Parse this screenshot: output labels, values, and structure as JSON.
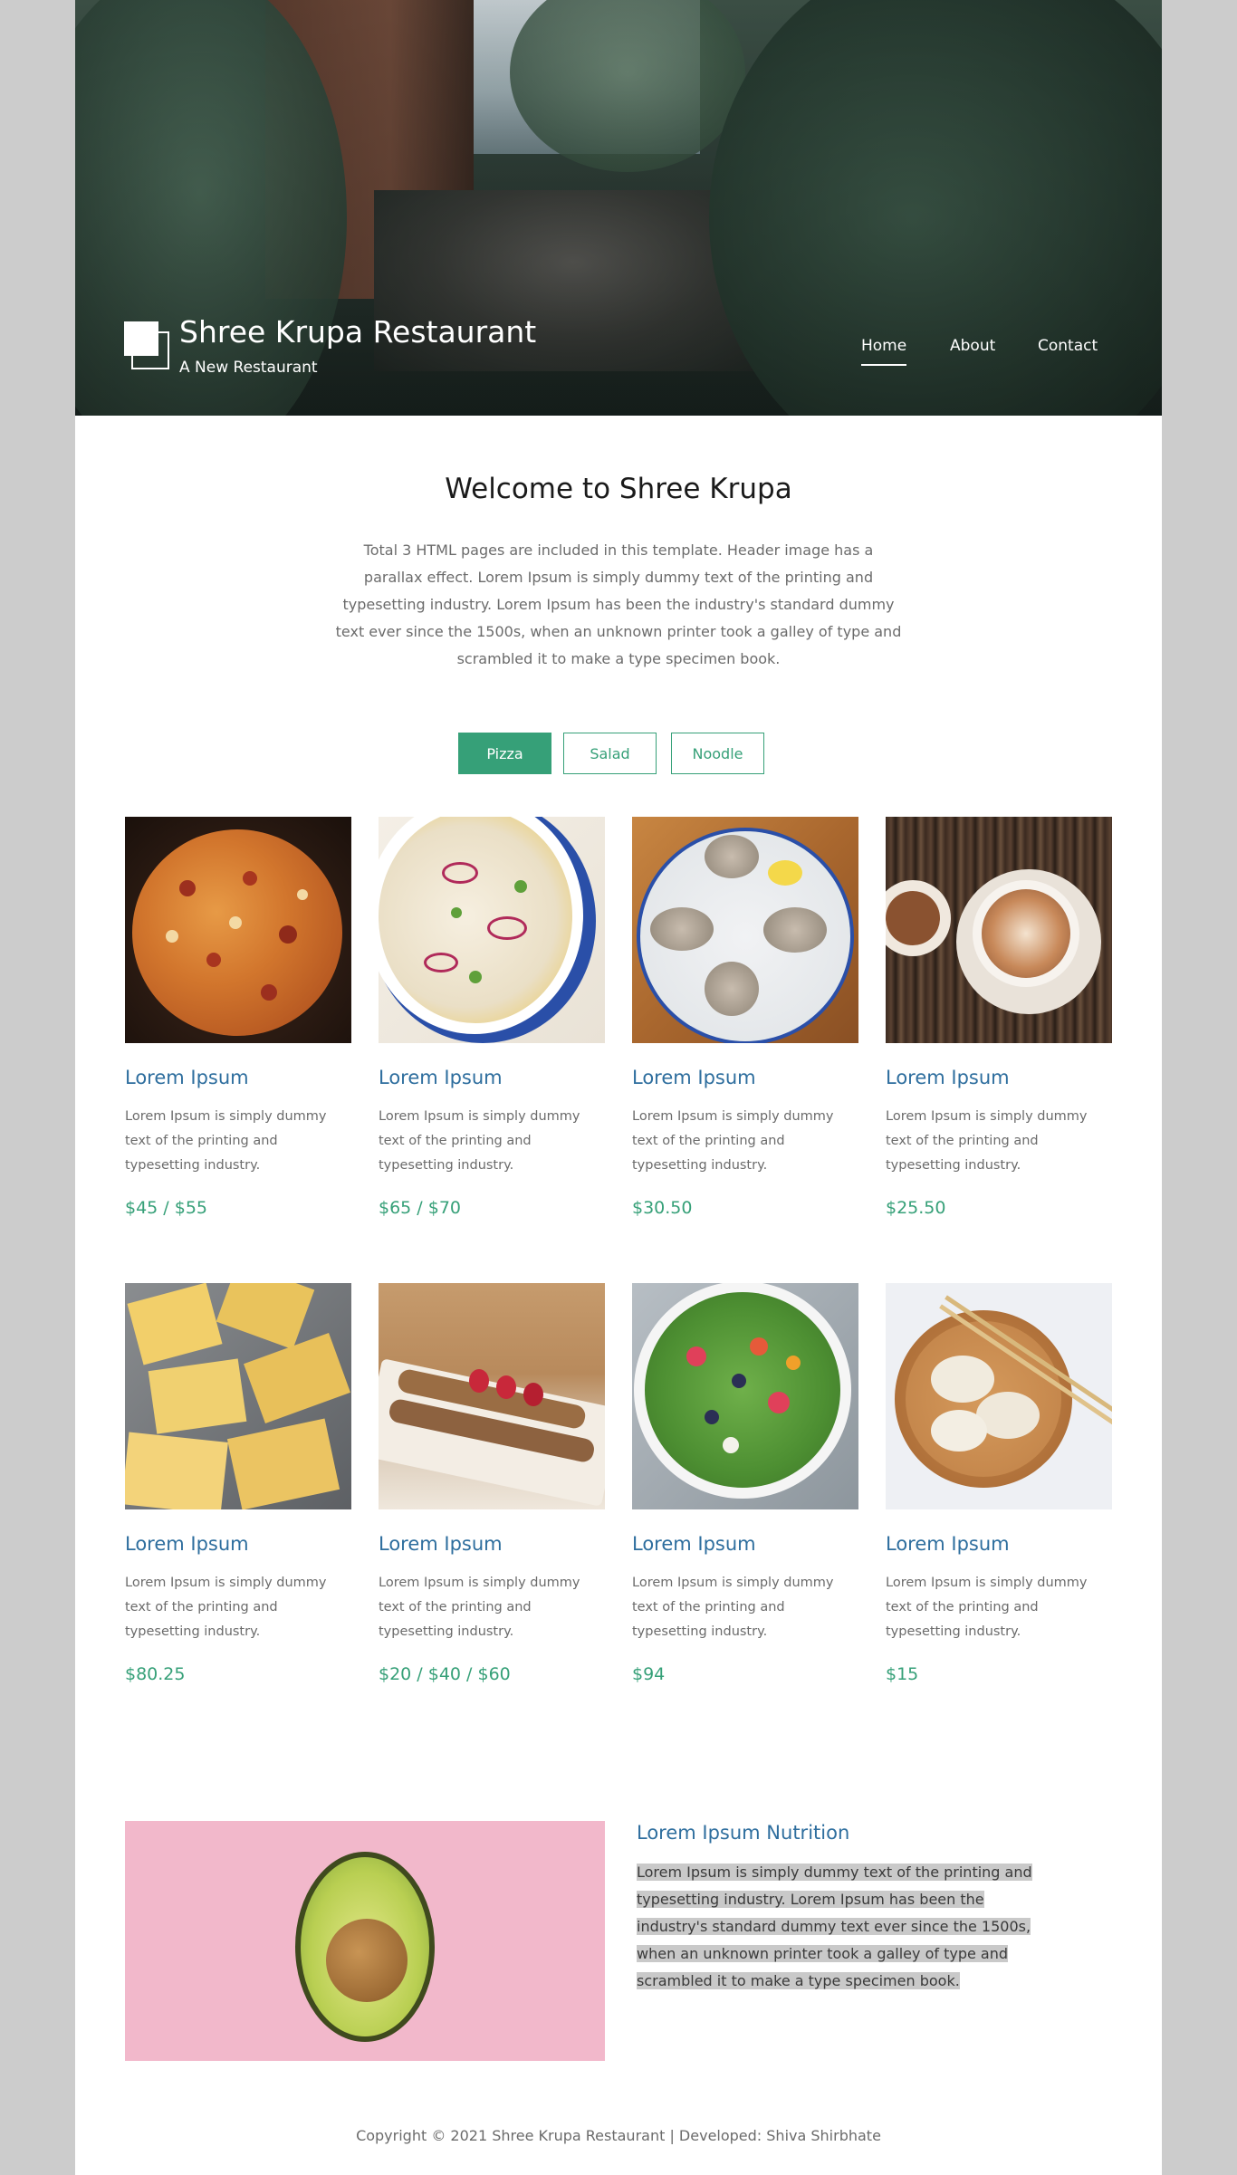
{
  "header": {
    "brand_title": "Shree Krupa Restaurant",
    "brand_subtitle": "A New Restaurant",
    "nav": [
      {
        "label": "Home",
        "active": true
      },
      {
        "label": "About",
        "active": false
      },
      {
        "label": "Contact",
        "active": false
      }
    ]
  },
  "welcome": {
    "title": "Welcome to Shree Krupa",
    "text": "Total 3 HTML pages are included in this template. Header image has a parallax effect. Lorem Ipsum is simply dummy text of the printing and typesetting industry. Lorem Ipsum has been the industry's standard dummy text ever since the 1500s, when an unknown printer took a galley of type and scrambled it to make a type specimen book."
  },
  "tabs": [
    {
      "label": "Pizza",
      "active": true
    },
    {
      "label": "Salad",
      "active": false
    },
    {
      "label": "Noodle",
      "active": false
    }
  ],
  "menu_items": [
    {
      "name": "Lorem Ipsum",
      "desc": "Lorem Ipsum is simply dummy text of the printing and typesetting industry.",
      "price": "$45 / $55"
    },
    {
      "name": "Lorem Ipsum",
      "desc": "Lorem Ipsum is simply dummy text of the printing and typesetting industry.",
      "price": "$65 / $70"
    },
    {
      "name": "Lorem Ipsum",
      "desc": "Lorem Ipsum is simply dummy text of the printing and typesetting industry.",
      "price": "$30.50"
    },
    {
      "name": "Lorem Ipsum",
      "desc": "Lorem Ipsum is simply dummy text of the printing and typesetting industry.",
      "price": "$25.50"
    },
    {
      "name": "Lorem Ipsum",
      "desc": "Lorem Ipsum is simply dummy text of the printing and typesetting industry.",
      "price": "$80.25"
    },
    {
      "name": "Lorem Ipsum",
      "desc": "Lorem Ipsum is simply dummy text of the printing and typesetting industry.",
      "price": "$20 / $40 / $60"
    },
    {
      "name": "Lorem Ipsum",
      "desc": "Lorem Ipsum is simply dummy text of the printing and typesetting industry.",
      "price": "$94"
    },
    {
      "name": "Lorem Ipsum",
      "desc": "Lorem Ipsum is simply dummy text of the printing and typesetting industry.",
      "price": "$15"
    }
  ],
  "nutrition": {
    "title": "Lorem Ipsum Nutrition",
    "text": "Lorem Ipsum is simply dummy text of the printing and typesetting industry. Lorem Ipsum has been the industry's standard dummy text ever since the 1500s, when an unknown printer took a galley of type and scrambled it to make a type specimen book."
  },
  "footer": {
    "text": "Copyright © 2021 Shree Krupa Restaurant | Developed: Shiva Shirbhate"
  },
  "colors": {
    "accent_green": "#36a078",
    "title_blue": "#2e6e9e",
    "page_bg": "#cccccc"
  },
  "icons": [
    "logo-icon"
  ]
}
